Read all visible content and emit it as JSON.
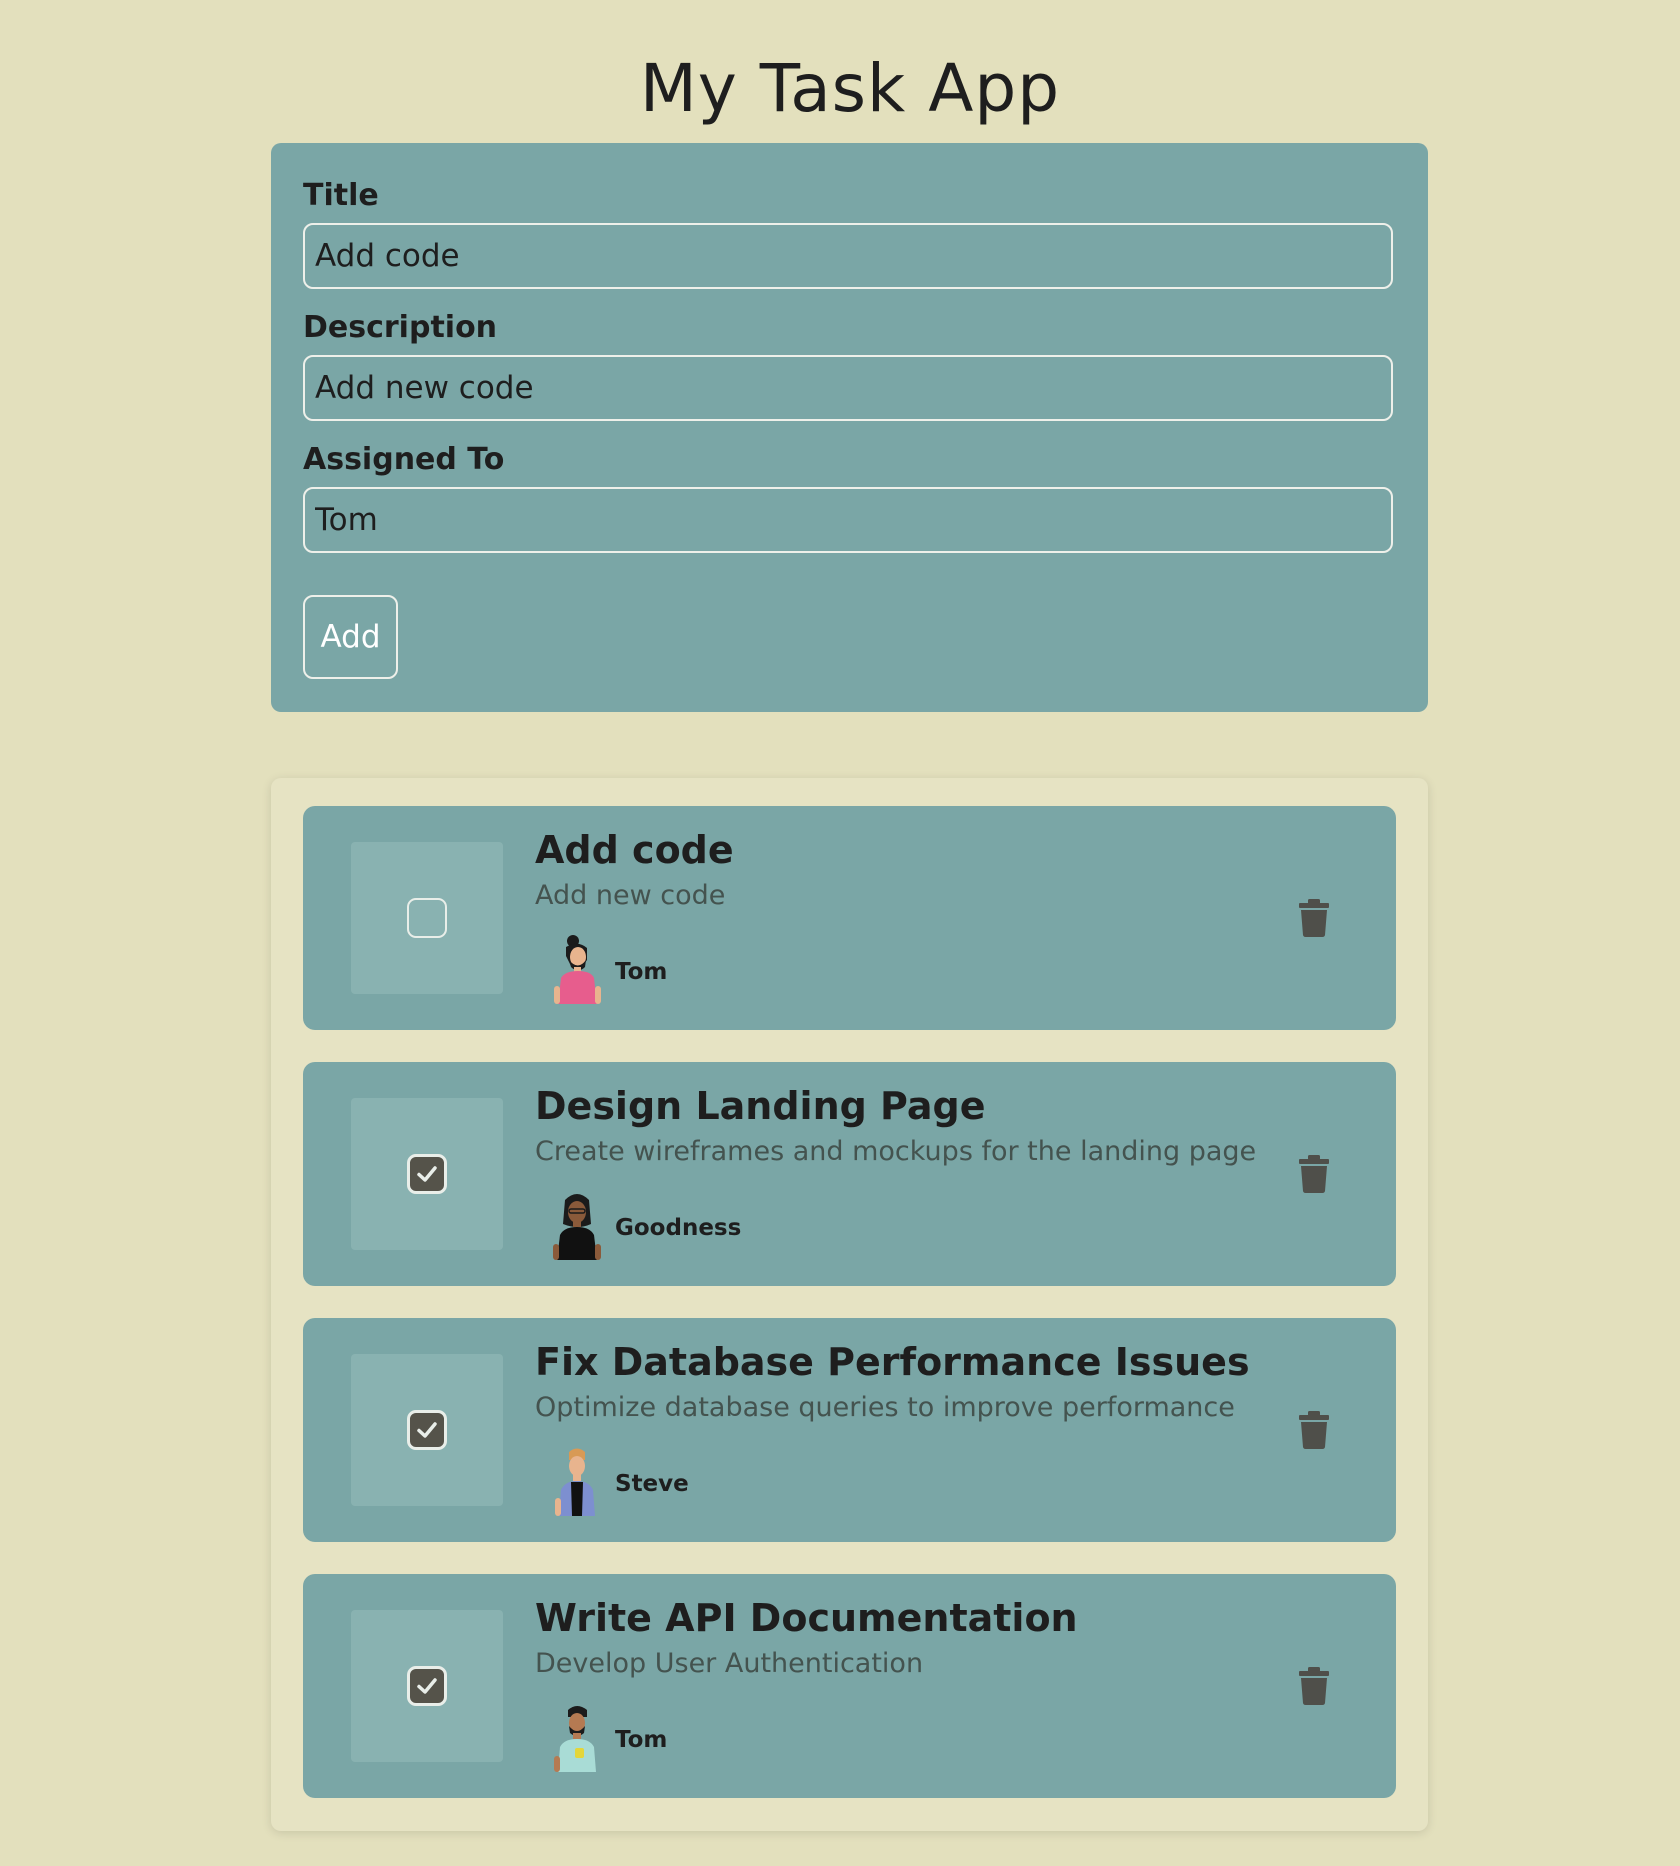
{
  "app": {
    "title": "My Task App"
  },
  "form": {
    "title_label": "Title",
    "title_value": "Add code",
    "description_label": "Description",
    "description_value": "Add new code",
    "assigned_label": "Assigned To",
    "assigned_value": "Tom",
    "add_label": "Add"
  },
  "tasks": [
    {
      "title": "Add code",
      "description": "Add new code",
      "assignee": "Tom",
      "completed": false,
      "avatar_icon": "avatar-man-pink-shirt-icon"
    },
    {
      "title": "Design Landing Page",
      "description": "Create wireframes and mockups for the landing page",
      "assignee": "Goodness",
      "completed": true,
      "avatar_icon": "avatar-woman-black-shirt-icon"
    },
    {
      "title": "Fix Database Performance Issues",
      "description": "Optimize database queries to improve performance",
      "assignee": "Steve",
      "completed": true,
      "avatar_icon": "avatar-person-cardigan-icon"
    },
    {
      "title": "Write API Documentation",
      "description": "Develop User Authentication",
      "assignee": "Tom",
      "completed": true,
      "avatar_icon": "avatar-man-coffee-icon"
    }
  ],
  "icons": {
    "delete": "trash-icon",
    "check": "check-icon"
  },
  "colors": {
    "background": "#e3e0bd",
    "card": "#7aa6a6",
    "check_tile": "#89b2b1",
    "checkbox_checked": "#55534a",
    "trash": "#4f4f4a"
  }
}
